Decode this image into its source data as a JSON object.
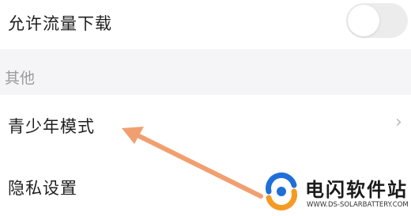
{
  "settings": {
    "data_download": {
      "label": "允许流量下载",
      "enabled": false
    },
    "section_other": {
      "label": "其他"
    },
    "teen_mode": {
      "label": "青少年模式",
      "chevron": "›"
    },
    "privacy": {
      "label": "隐私设置"
    }
  },
  "annotation": {
    "arrow_color": "#f0a070",
    "points_to": "teen_mode"
  },
  "watermark": {
    "title": "电闪软件站",
    "url": "WWW.DS-SOLARBATTERY.COM",
    "logo_colors": {
      "blue": "#1e6fd9",
      "orange": "#f59a23"
    }
  },
  "colors": {
    "section_bg": "#f5f5f7",
    "toggle_off": "#ececec",
    "text_primary": "#1f1f1f",
    "text_secondary": "#9b9b9b"
  }
}
